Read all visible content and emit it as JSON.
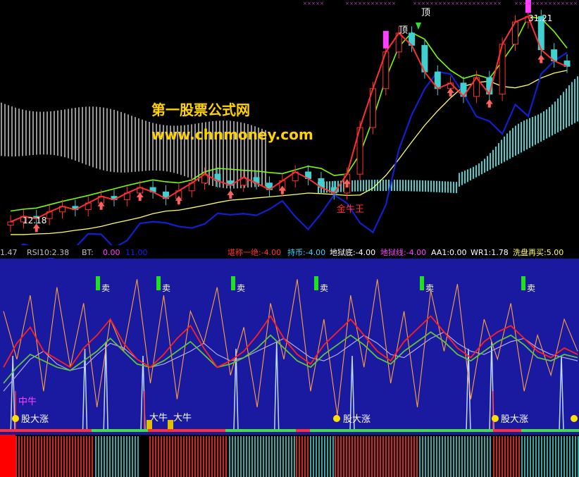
{
  "watermark": {
    "line1": "第一股票公式网",
    "line2": "www.chnmoney.com",
    "color": "#ffd200"
  },
  "price_panel": {
    "high_label": "31.21",
    "low_label": "12.18",
    "top_markers": [
      "顶",
      "顶"
    ],
    "bull_label": "金牛王",
    "colors": {
      "background": "#000000",
      "price_line": "#ff3030",
      "fast_line": "#7cfc00",
      "slow_line": "#ffff66",
      "blue_line": "#1020d0",
      "cloud_grey": "#b0b0b0",
      "cloud_cyan": "#40d0d0",
      "candle_up": "#ff3030",
      "candle_down": "#40d0d0",
      "arrow": "#ff6060",
      "magenta": "#ff40ff"
    }
  },
  "indicator_bar": {
    "items": [
      {
        "text": "1.47",
        "color": "#c0c0c0"
      },
      {
        "text": "RSI10:2.38",
        "color": "#c0c0c0"
      },
      {
        "text": "BT:",
        "color": "#c0c0c0"
      },
      {
        "text": "0.00",
        "color": "#ff40ff"
      },
      {
        "text": "11.00",
        "color": "#1a1aff"
      },
      {
        "text": "堪称一绝:-4.00",
        "color": "#ff3030"
      },
      {
        "text": "持币:-4.00",
        "color": "#40d0ff"
      },
      {
        "text": "地狱底:-4.00",
        "color": "#ffffff"
      },
      {
        "text": "地狱线:-4.00",
        "color": "#ff40ff"
      },
      {
        "text": "AA1:0.00",
        "color": "#ffffff"
      },
      {
        "text": "WR1:1.78",
        "color": "#ffffff"
      },
      {
        "text": "洗盘再买:5.00",
        "color": "#ffff66"
      }
    ]
  },
  "oscillator_panel": {
    "background": "#1a1aa0",
    "sell_label": "卖",
    "labels": {
      "zhong_niu": "中牛",
      "dazhang_1": "股大涨",
      "daniu_1": "大牛",
      "daniu_2": "大牛",
      "dazhang_2": "股大涨",
      "dazhang_3": "股大涨"
    },
    "colors": {
      "orange_line": "#ffa040",
      "red_line": "#ff2020",
      "green_line": "#60c040",
      "lavender_line": "#b0a8e8",
      "spike": "#c0d8ff",
      "sell_marker": "#20e020",
      "yellow_dot": "#ffe000"
    }
  },
  "chart_data": {
    "type": "line",
    "title": "",
    "price": {
      "low": 12.18,
      "high": 31.21,
      "close_series": [
        12.5,
        13.0,
        12.8,
        13.4,
        13.9,
        13.6,
        14.2,
        14.8,
        14.5,
        15.1,
        15.6,
        15.2,
        14.6,
        15.3,
        16.0,
        16.8,
        16.2,
        15.8,
        16.5,
        16.0,
        15.4,
        16.2,
        17.0,
        16.4,
        15.6,
        15.1,
        16.8,
        21.0,
        24.5,
        27.8,
        29.5,
        28.4,
        26.0,
        24.5,
        25.0,
        23.8,
        25.5,
        24.0,
        28.5,
        30.5,
        31.0,
        28.0,
        27.0,
        26.5
      ]
    },
    "oscillator": {
      "range": [
        0,
        100
      ],
      "orange": [
        75,
        45,
        85,
        25,
        90,
        40,
        80,
        15,
        70,
        50,
        95,
        30,
        85,
        20,
        75,
        55,
        90,
        35,
        65,
        15,
        80,
        45,
        95,
        25,
        70,
        10,
        85,
        40,
        95,
        30,
        75,
        15,
        88,
        50,
        92,
        20,
        70,
        45,
        80,
        25,
        60,
        35,
        70,
        50
      ],
      "red": [
        40,
        55,
        65,
        50,
        45,
        40,
        52,
        60,
        70,
        55,
        45,
        40,
        48,
        58,
        66,
        52,
        40,
        44,
        50,
        60,
        72,
        58,
        48,
        42,
        54,
        62,
        70,
        60,
        50,
        44,
        56,
        64,
        72,
        62,
        52,
        46,
        56,
        62,
        66,
        58,
        50,
        46,
        52,
        48
      ],
      "green": [
        30,
        40,
        48,
        44,
        40,
        38,
        44,
        50,
        58,
        50,
        42,
        40,
        44,
        50,
        56,
        48,
        40,
        42,
        46,
        52,
        60,
        52,
        44,
        40,
        48,
        54,
        60,
        54,
        46,
        42,
        50,
        56,
        62,
        56,
        48,
        44,
        50,
        56,
        60,
        54,
        46,
        44,
        48,
        46
      ],
      "lavender": [
        25,
        35,
        45,
        50,
        42,
        38,
        40,
        48,
        55,
        52,
        45,
        40,
        42,
        46,
        50,
        55,
        48,
        44,
        46,
        50,
        54,
        58,
        52,
        46,
        44,
        48,
        54,
        60,
        55,
        48,
        46,
        52,
        58,
        62,
        55,
        50,
        48,
        52,
        56,
        58,
        52,
        48,
        46,
        44
      ]
    }
  }
}
